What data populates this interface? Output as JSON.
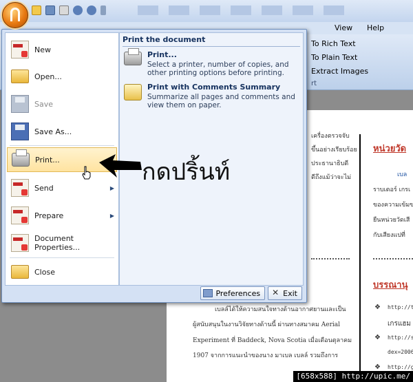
{
  "ribbon": {
    "menus": [
      "Help",
      "View"
    ],
    "commands": [
      "To Rich Text",
      "To Plain Text",
      "Extract Images"
    ],
    "group_fragment": "rt"
  },
  "office_menu": {
    "items": [
      {
        "label": "New",
        "icon": "pdf-new-icon",
        "enabled": true
      },
      {
        "label": "Open...",
        "icon": "folder-open-icon",
        "enabled": true
      },
      {
        "label": "Save",
        "icon": "floppy-disk-icon",
        "enabled": false
      },
      {
        "label": "Save As...",
        "icon": "save-as-icon",
        "enabled": true
      },
      {
        "label": "Print...",
        "icon": "printer-icon",
        "enabled": true,
        "highlighted": true
      },
      {
        "label": "Send",
        "icon": "send-icon",
        "enabled": true,
        "submenu": true
      },
      {
        "label": "Prepare",
        "icon": "prepare-icon",
        "enabled": true,
        "submenu": true
      },
      {
        "label": "Document Properties...",
        "icon": "document-properties-icon",
        "enabled": true
      },
      {
        "label": "Close",
        "icon": "close-folder-icon",
        "enabled": true
      }
    ],
    "submenu_glyph": "▶",
    "pane": {
      "title": "Print the document",
      "entries": [
        {
          "title": "Print...",
          "description": "Select a printer, number of copies, and other printing options before printing.",
          "icon": "printer-icon"
        },
        {
          "title": "Print with Comments Summary",
          "description": "Summarize all pages and comments and view them on paper.",
          "icon": "print-comments-icon"
        }
      ]
    },
    "footer": {
      "preferences": "Preferences",
      "exit": "Exit"
    }
  },
  "annotation": {
    "text": "กดปริ้นท์"
  },
  "document": {
    "lines_left": [
      "เครื่องตรวจจับ",
      "ขึ้นอย่างเรียบร้อย",
      "ประธานาธิบดี",
      "ดีถึงแม้ว่าจะไม่"
    ],
    "body_lines": [
      "เบลล์ได้ให้ความสนใจทางด้านอากาศยานและเป็น",
      "ผู้สนับสนุนในงานวิจัยทางด้านนี้ ผ่านทางสมาคม Aerial",
      "Experiment ที่ Baddeck, Nova Scotia เมื่อเดือนตุลาคม",
      "1907 จากการแนะนำของนาง มาเบล เบลล์ รวมถึงการ"
    ],
    "right_heading_1": "หน่วยวัด",
    "right_label": "เบล",
    "right_lines": [
      "ราบเตอร์ เกรเ",
      "ของความเข้มข",
      "ยืนหน่วยวัดเสี",
      "กับเสียงแปที่"
    ],
    "right_heading_2": "บรรณานุ",
    "bullets": [
      {
        "glyph": "❖",
        "text": "http://th"
      },
      {
        "glyph": "",
        "text": "เกรแฮม"
      },
      {
        "glyph": "❖",
        "text": "http://sl"
      },
      {
        "glyph": "",
        "text": "dex=2006"
      },
      {
        "glyph": "❖",
        "text": "http://gl"
      }
    ]
  },
  "watermark": "[658x588] http://upic.me/"
}
